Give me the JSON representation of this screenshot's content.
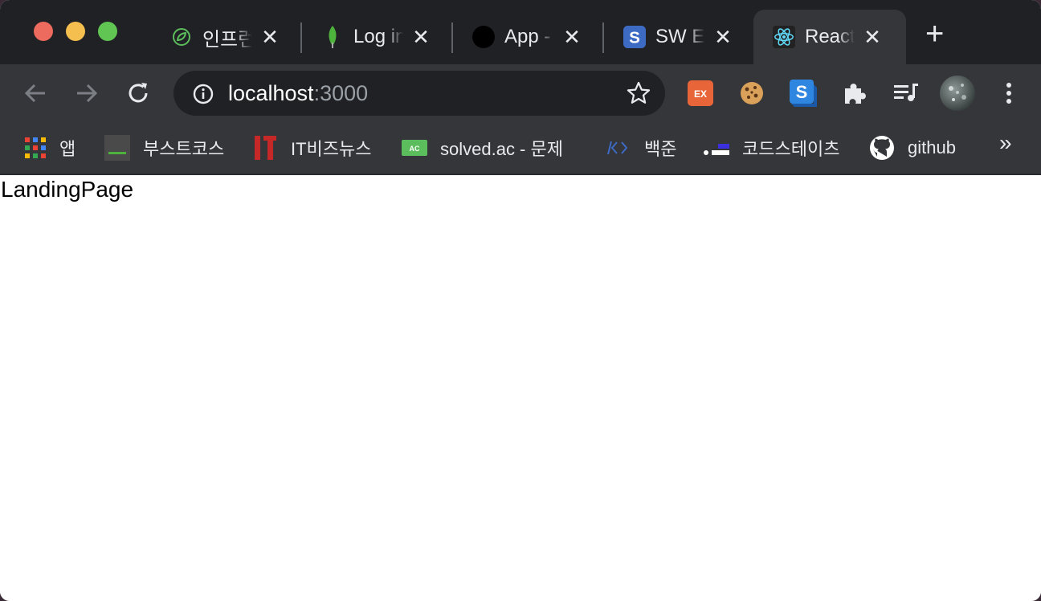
{
  "tabs": [
    {
      "title": "인프런",
      "icon": "inflearn-leaf-icon"
    },
    {
      "title": "Log in",
      "icon": "mongodb-leaf-icon"
    },
    {
      "title": "App -",
      "icon": "black-circle-icon"
    },
    {
      "title": "SW E",
      "icon": "s-logo-icon"
    },
    {
      "title": "React",
      "icon": "react-atom-icon",
      "active": true
    }
  ],
  "toolbar": {
    "url_host": "localhost",
    "url_port": ":3000"
  },
  "extensions": [
    "ex-extension-icon",
    "cookie-extension-icon",
    "s-extension-icon",
    "puzzle-icon",
    "media-list-icon",
    "profile-avatar",
    "kebab-menu-icon"
  ],
  "bookmarks": [
    {
      "label": "앱",
      "icon": "apps-grid-icon"
    },
    {
      "label": "부스트코스",
      "icon": "boostcourse-icon"
    },
    {
      "label": "IT비즈뉴스",
      "icon": "it-news-icon"
    },
    {
      "label": "solved.ac - 문제",
      "icon": "solvedac-icon"
    },
    {
      "label": "백준",
      "icon": "code-brackets-icon"
    },
    {
      "label": "코드스테이츠",
      "icon": "codestates-icon"
    },
    {
      "label": "github",
      "icon": "github-icon"
    }
  ],
  "bookmarks_more": "»",
  "page": {
    "content": "LandingPage"
  },
  "colors": {
    "tabstrip": "#202124",
    "toolbar": "#35363a",
    "react": "#61dafb",
    "mongodb": "#4db33d",
    "inflearn": "#5bbd5b"
  }
}
